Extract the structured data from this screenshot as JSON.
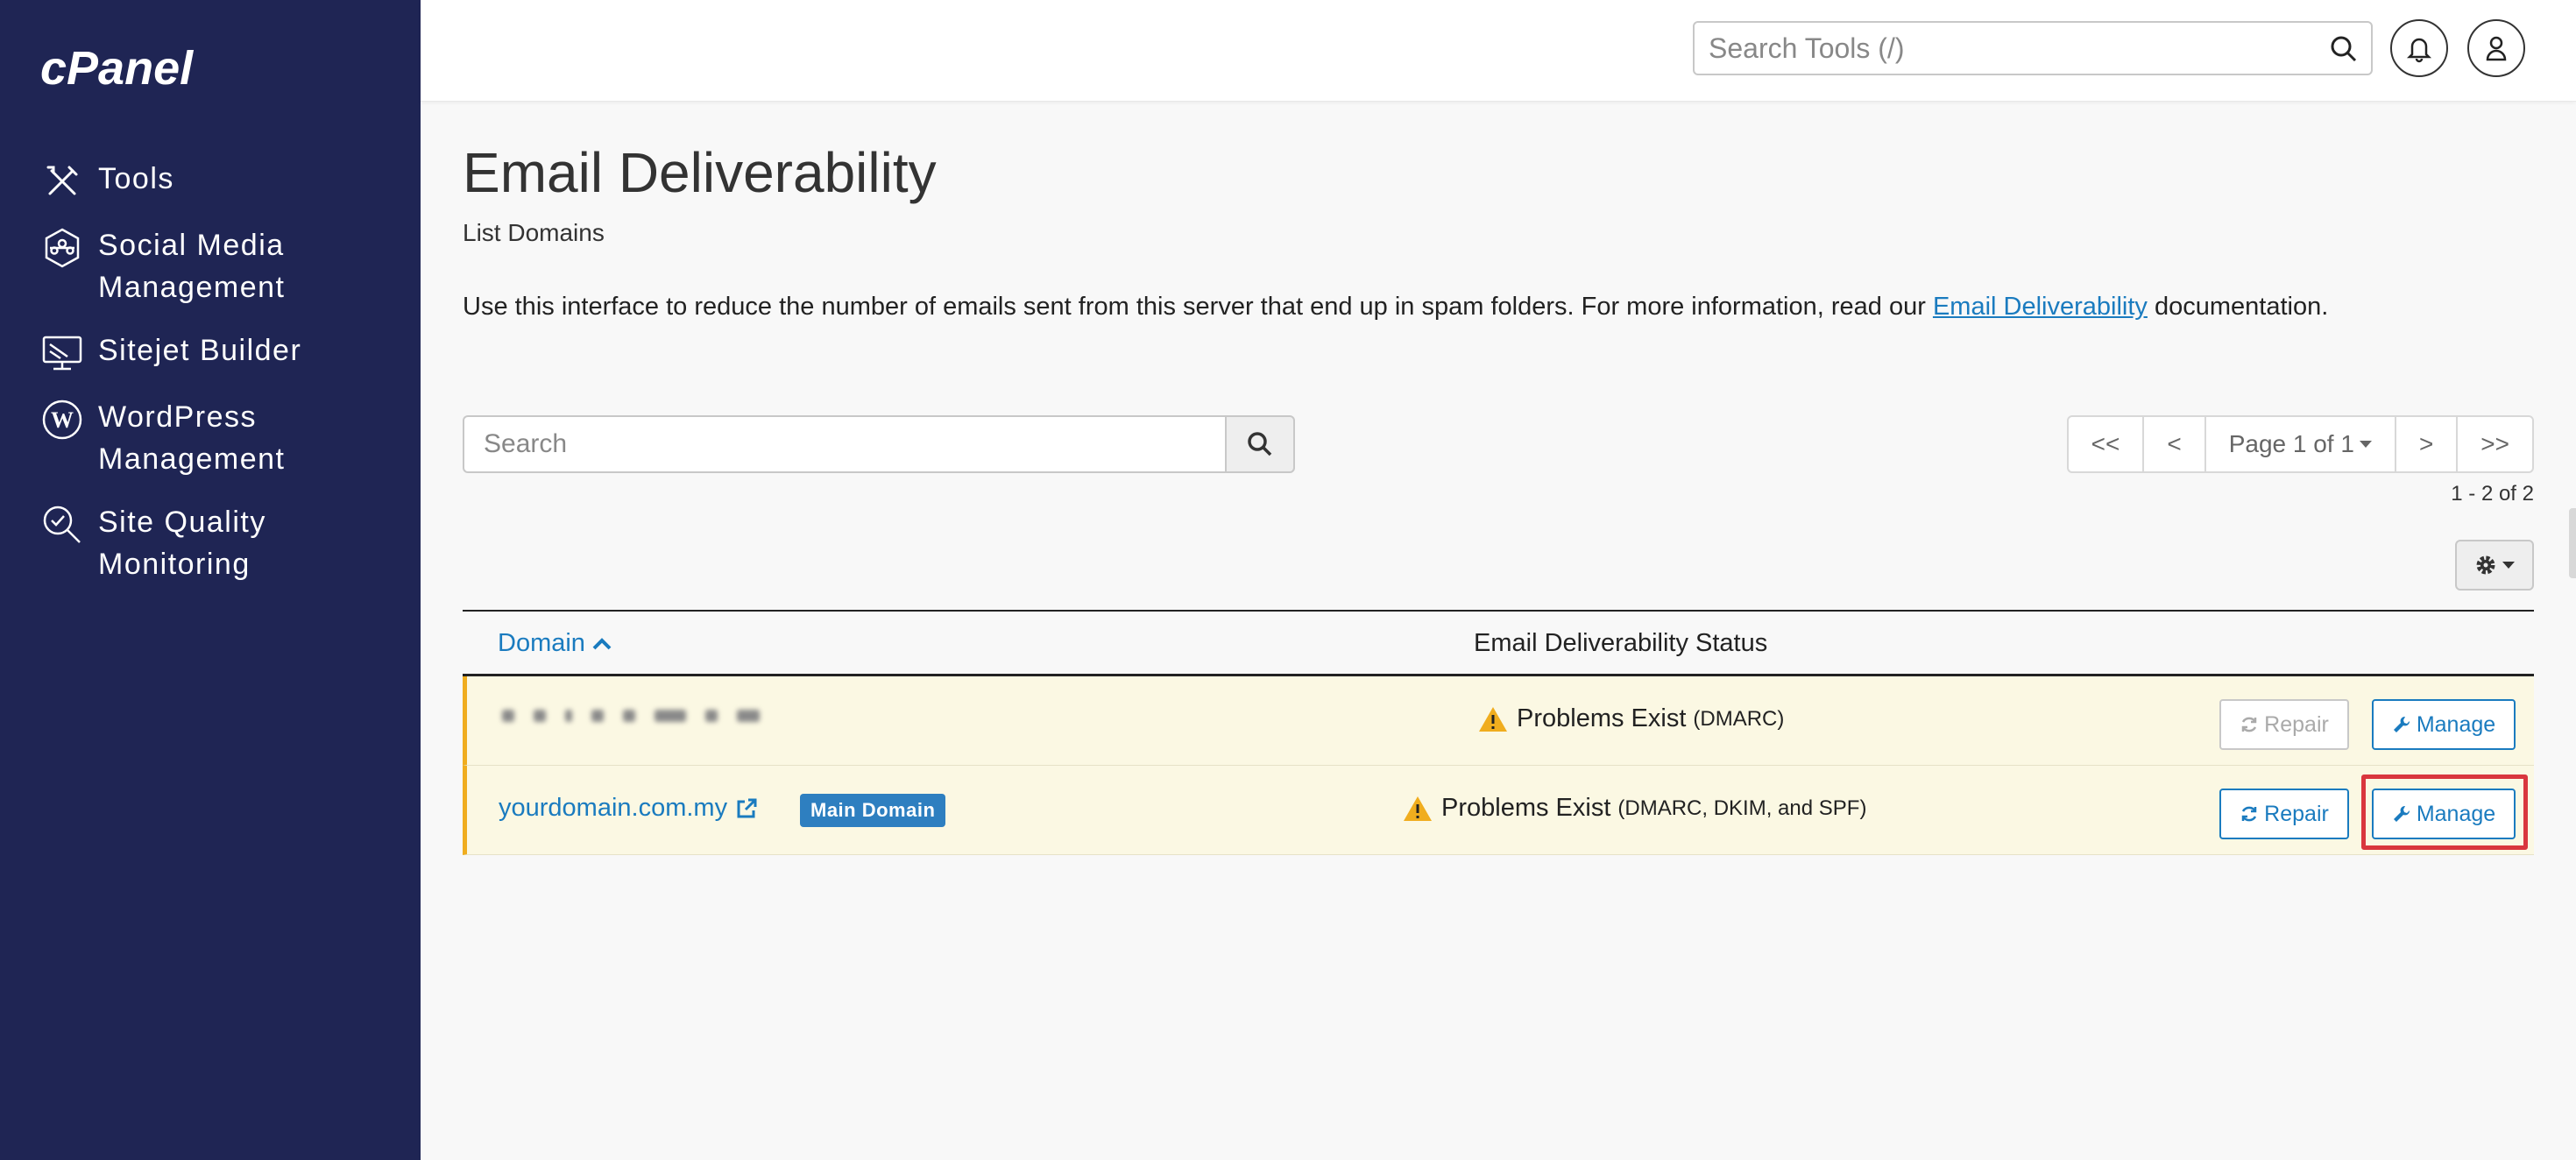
{
  "sidebar": {
    "logo": "cPanel",
    "items": [
      {
        "label": "Tools",
        "icon": "tools-icon"
      },
      {
        "label": "Social Media Management",
        "icon": "social-media-icon"
      },
      {
        "label": "Sitejet Builder",
        "icon": "sitejet-icon"
      },
      {
        "label": "WordPress Management",
        "icon": "wordpress-icon"
      },
      {
        "label": "Site Quality Monitoring",
        "icon": "site-quality-icon"
      }
    ]
  },
  "header": {
    "search_placeholder": "Search Tools (/)"
  },
  "main": {
    "title": "Email Deliverability",
    "subtitle": "List Domains",
    "description_prefix": "Use this interface to reduce the number of emails sent from this server that end up in spam folders. For more information, read our ",
    "description_link": "Email Deliverability",
    "description_suffix": " documentation.",
    "search_placeholder": "Search",
    "pager": {
      "first": "<<",
      "prev": "<",
      "page": "Page 1 of 1",
      "next": ">",
      "last": ">>"
    },
    "result_count": "1 - 2 of 2",
    "table": {
      "col_domain": "Domain",
      "col_status": "Email Deliverability Status",
      "rows": [
        {
          "domain": "",
          "status": "Problems Exist",
          "detail": "(DMARC)",
          "repair": "Repair",
          "manage": "Manage"
        },
        {
          "domain": "yourdomain.com.my",
          "badge": "Main Domain",
          "status": "Problems Exist",
          "detail": "(DMARC, DKIM, and SPF)",
          "repair": "Repair",
          "manage": "Manage"
        }
      ]
    }
  },
  "colors": {
    "sidebar_bg": "#1f2554",
    "link": "#1a7bbf",
    "warning_row": "#fbf8e3",
    "warning_border": "#f0ad1e",
    "highlight": "#d9363e"
  }
}
